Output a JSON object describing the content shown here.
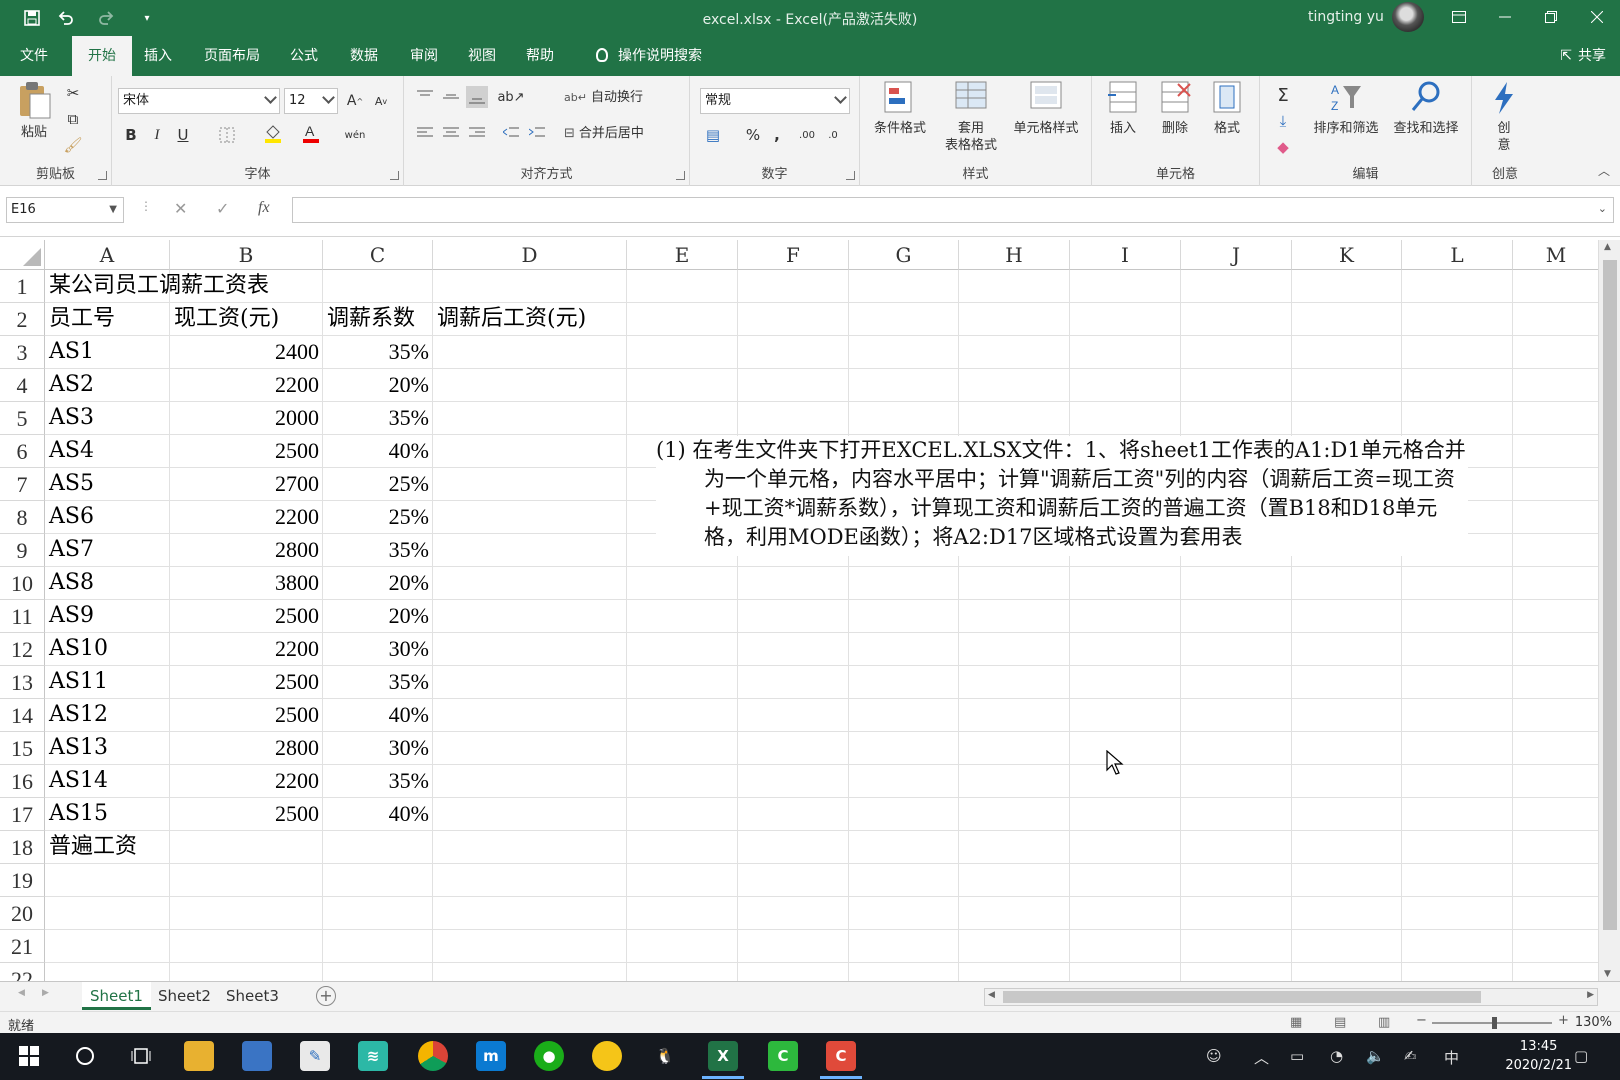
{
  "title_bar": {
    "title": "excel.xlsx  -  Excel(产品激活失败)",
    "user": "tingting yu"
  },
  "menu_tabs": [
    "文件",
    "开始",
    "插入",
    "页面布局",
    "公式",
    "数据",
    "审阅",
    "视图",
    "帮助"
  ],
  "search_label": "操作说明搜索",
  "share_label": "共享",
  "ribbon": {
    "clipboard": {
      "paste": "粘贴",
      "group": "剪贴板"
    },
    "font": {
      "name": "宋体",
      "size": "12",
      "group": "字体"
    },
    "alignment": {
      "wrap": "自动换行",
      "merge": "合并后居中",
      "group": "对齐方式"
    },
    "number": {
      "format": "常规",
      "group": "数字"
    },
    "styles": {
      "conditional": "条件格式",
      "table_1": "套用",
      "table_2": "表格格式",
      "cell_styles": "单元格样式",
      "group": "样式"
    },
    "cells": {
      "insert": "插入",
      "delete": "删除",
      "format": "格式",
      "group": "单元格"
    },
    "editing": {
      "sort": "排序和筛选",
      "find": "查找和选择",
      "group": "编辑"
    },
    "ideas": {
      "label_1": "创",
      "label_2": "意",
      "group": "创意"
    }
  },
  "formula_bar": {
    "name_box": "E16",
    "fx": "fx",
    "formula": ""
  },
  "columns": [
    "A",
    "B",
    "C",
    "D",
    "E",
    "F",
    "G",
    "H",
    "I",
    "J",
    "K",
    "L",
    "M"
  ],
  "rows": [
    "1",
    "2",
    "3",
    "4",
    "5",
    "6",
    "7",
    "8",
    "9",
    "10",
    "11",
    "12",
    "13",
    "14",
    "15",
    "16",
    "17",
    "18",
    "19",
    "20",
    "21",
    "22"
  ],
  "sheet": {
    "a1": "某公司员工调薪工资表",
    "headers": [
      "员工号",
      "现工资(元)",
      "调薪系数",
      "调薪后工资(元)"
    ],
    "data": [
      [
        "AS1",
        "2400",
        "35%"
      ],
      [
        "AS2",
        "2200",
        "20%"
      ],
      [
        "AS3",
        "2000",
        "35%"
      ],
      [
        "AS4",
        "2500",
        "40%"
      ],
      [
        "AS5",
        "2700",
        "25%"
      ],
      [
        "AS6",
        "2200",
        "25%"
      ],
      [
        "AS7",
        "2800",
        "35%"
      ],
      [
        "AS8",
        "3800",
        "20%"
      ],
      [
        "AS9",
        "2500",
        "20%"
      ],
      [
        "AS10",
        "2200",
        "30%"
      ],
      [
        "AS11",
        "2500",
        "35%"
      ],
      [
        "AS12",
        "2500",
        "40%"
      ],
      [
        "AS13",
        "2800",
        "30%"
      ],
      [
        "AS14",
        "2200",
        "35%"
      ],
      [
        "AS15",
        "2500",
        "40%"
      ]
    ],
    "a18": "普遍工资"
  },
  "note": "(1) 在考生文件夹下打开EXCEL.XLSX文件：1、将sheet1工作表的A1:D1单元格合并为一个单元格，内容水平居中；计算\"调薪后工资\"列的内容（调薪后工资=现工资+现工资*调薪系数），计算现工资和调薪后工资的普遍工资（置B18和D18单元格，利用MODE函数）；将A2:D17区域格式设置为套用表",
  "sheet_tabs": [
    "Sheet1",
    "Sheet2",
    "Sheet3"
  ],
  "status": {
    "ready": "就绪",
    "zoom": "130%"
  },
  "taskbar": {
    "time": "13:45",
    "date": "2020/2/21",
    "ime": "中"
  },
  "colors": {
    "excel_green": "#217346",
    "taskbar": "#15191f"
  }
}
